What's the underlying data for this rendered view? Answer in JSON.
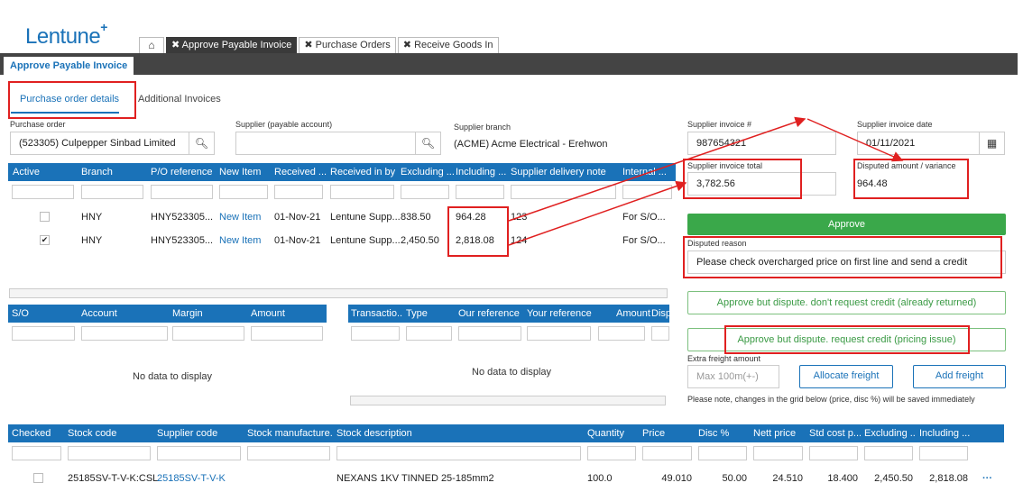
{
  "app": {
    "logo": "Lentune",
    "logo_mark": "+"
  },
  "tabs": [
    {
      "label": "Approve Payable Invoice"
    },
    {
      "label": "Purchase Orders"
    },
    {
      "label": "Receive Goods In"
    }
  ],
  "page_tab": "Approve Payable Invoice",
  "subtabs": [
    "Purchase order details",
    "Additional Invoices"
  ],
  "fields": {
    "purchase_order": {
      "label": "Purchase order",
      "value": "(523305) Culpepper Sinbad Limited"
    },
    "supplier": {
      "label": "Supplier (payable account)",
      "value": ""
    },
    "supplier_branch": {
      "label": "Supplier branch",
      "value": "(ACME) Acme Electrical - Erehwon"
    },
    "invoice_no": {
      "label": "Supplier invoice #",
      "value": "987654321"
    },
    "invoice_date": {
      "label": "Supplier invoice date",
      "value": "01/11/2021"
    },
    "invoice_total": {
      "label": "Supplier invoice total",
      "value": "3,782.56"
    },
    "disputed_amount": {
      "label": "Disputed amount / variance",
      "value": "964.48"
    },
    "disputed_reason": {
      "label": "Disputed reason",
      "value": "Please check overcharged price on first line and send a credit"
    },
    "extra_freight": {
      "label": "Extra freight amount",
      "placeholder": "Max 100m(+-)"
    }
  },
  "buttons": {
    "approve": "Approve",
    "dispute_no_credit": "Approve but dispute. don't request credit (already returned)",
    "dispute_credit": "Approve but dispute. request credit (pricing issue)",
    "allocate_freight": "Allocate freight",
    "add_freight": "Add freight"
  },
  "note": "Please note, changes in the grid below (price, disc %) will be saved immediately",
  "po_grid": {
    "headers": [
      "Active",
      "Branch",
      "P/O reference",
      "New Item",
      "Received ...",
      "Received in by",
      "Excluding ...",
      "Including ...",
      "Supplier delivery note",
      "Internal ..."
    ],
    "rows": [
      {
        "branch": "HNY",
        "po_ref": "HNY523305...",
        "new_item": "New Item",
        "received": "01-Nov-21",
        "received_by": "Lentune Supp...",
        "excl": "838.50",
        "incl": "964.28",
        "note": "123",
        "internal": "For S/O..."
      },
      {
        "branch": "HNY",
        "po_ref": "HNY523305...",
        "new_item": "New Item",
        "received": "01-Nov-21",
        "received_by": "Lentune Supp...",
        "excl": "2,450.50",
        "incl": "2,818.08",
        "note": "124",
        "internal": "For S/O..."
      }
    ]
  },
  "so_grid": {
    "headers": [
      "S/O",
      "Account",
      "Margin",
      "Amount"
    ],
    "empty": "No data to display"
  },
  "tx_grid": {
    "headers": [
      "Transactio...",
      "Type",
      "Our reference",
      "Your reference",
      "Amount",
      "Disp"
    ],
    "empty": "No data to display"
  },
  "lines_grid": {
    "headers": [
      "Checked",
      "Stock code",
      "Supplier code",
      "Stock manufacture...",
      "Stock description",
      "Quantity",
      "Price",
      "Disc %",
      "Nett price",
      "Std cost p...",
      "Excluding ...",
      "Including ..."
    ],
    "rows": [
      {
        "stock_code": "25185SV-T-V-K:CSL",
        "supplier_code": "25185SV-T-V-K",
        "manufacturer": "",
        "description": "NEXANS 1KV TINNED 25-185mm2",
        "quantity": "100.0",
        "price": "49.010",
        "disc": "50.00",
        "nett": "24.510",
        "std_cost": "18.400",
        "excl": "2,450.50",
        "incl": "2,818.08",
        "more": "···"
      }
    ]
  },
  "colors": {
    "accent": "#1a72b8",
    "approve": "#3aa84a",
    "highlight": "#e02020"
  }
}
